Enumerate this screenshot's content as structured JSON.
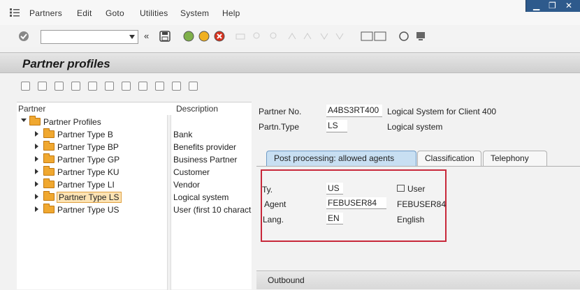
{
  "menubar": {
    "items": [
      "Partners",
      "Edit",
      "Goto",
      "Utilities",
      "System",
      "Help"
    ]
  },
  "toolbar": {
    "command_field_value": "",
    "double_arrow": "«"
  },
  "title": "Partner profiles",
  "tree": {
    "col_partner": "Partner",
    "col_description": "Description",
    "root": "Partner Profiles",
    "items": [
      {
        "label": "Partner Type B",
        "desc": "Bank"
      },
      {
        "label": "Partner Type BP",
        "desc": "Benefits provider"
      },
      {
        "label": "Partner Type GP",
        "desc": "Business Partner"
      },
      {
        "label": "Partner Type KU",
        "desc": "Customer"
      },
      {
        "label": "Partner Type LI",
        "desc": "Vendor"
      },
      {
        "label": "Partner Type LS",
        "desc": "Logical system"
      },
      {
        "label": "Partner Type US",
        "desc": "User (first 10 charact"
      }
    ]
  },
  "partner": {
    "no_label": "Partner No.",
    "no_value": "A4BS3RT400",
    "no_text": "Logical System for Client 400",
    "type_label": "Partn.Type",
    "type_value": "LS",
    "type_text": "Logical system"
  },
  "tabs": [
    "Post processing: allowed agents",
    "Classification",
    "Telephony"
  ],
  "agent_box": {
    "ty_label": "Ty.",
    "ty_value": "US",
    "ty_text": "User",
    "agent_label": "Agent",
    "agent_value": "FEBUSER84",
    "agent_text": "FEBUSER84",
    "lang_label": "Lang.",
    "lang_value": "EN",
    "lang_text": "English"
  },
  "outbound": "Outbound",
  "colors": {
    "accent_box": "#c8283a",
    "active_tab": "#c8dff2",
    "folder": "#f0a830"
  }
}
